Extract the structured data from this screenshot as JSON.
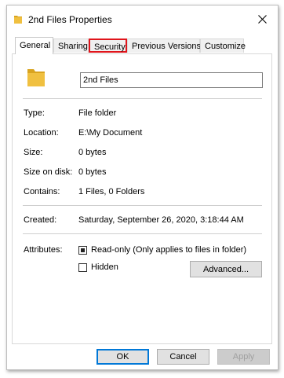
{
  "window": {
    "title": "2nd Files Properties"
  },
  "tabs": [
    {
      "label": "General",
      "active": true
    },
    {
      "label": "Sharing"
    },
    {
      "label": "Security",
      "highlighted": true
    },
    {
      "label": "Previous Versions"
    },
    {
      "label": "Customize"
    }
  ],
  "general": {
    "name_value": "2nd Files",
    "rows": {
      "type": {
        "label": "Type:",
        "value": "File folder"
      },
      "location": {
        "label": "Location:",
        "value": "E:\\My Document"
      },
      "size": {
        "label": "Size:",
        "value": "0 bytes"
      },
      "size_on_disk": {
        "label": "Size on disk:",
        "value": "0 bytes"
      },
      "contains": {
        "label": "Contains:",
        "value": "1 Files, 0 Folders"
      },
      "created": {
        "label": "Created:",
        "value": "Saturday, September 26, 2020, 3:18:44 AM"
      }
    },
    "attributes": {
      "label": "Attributes:",
      "readonly": {
        "label": "Read-only (Only applies to files in folder)",
        "checked": true
      },
      "hidden": {
        "label": "Hidden",
        "checked": false
      },
      "advanced_label": "Advanced..."
    }
  },
  "buttons": {
    "ok": "OK",
    "cancel": "Cancel",
    "apply": "Apply"
  },
  "colors": {
    "folder": "#f0c040",
    "folder_dark": "#d9a420",
    "highlight": "#e0151b",
    "accent": "#0078d7"
  }
}
